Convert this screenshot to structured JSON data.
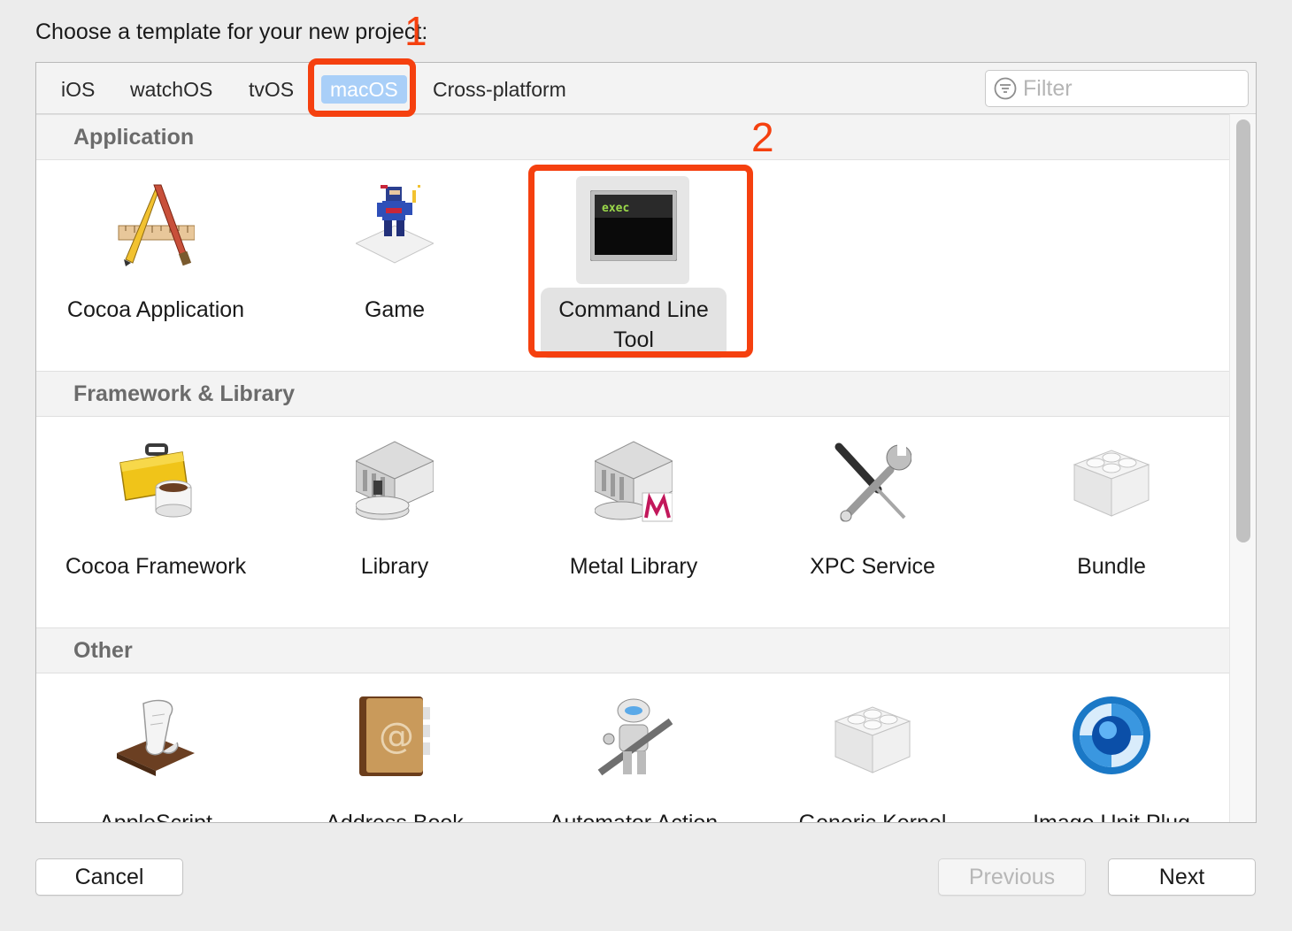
{
  "prompt": "Choose a template for your new project:",
  "tabs": [
    {
      "label": "iOS"
    },
    {
      "label": "watchOS"
    },
    {
      "label": "tvOS"
    },
    {
      "label": "macOS",
      "selected": true
    },
    {
      "label": "Cross-platform"
    }
  ],
  "filter": {
    "placeholder": "Filter",
    "icon": "filter-icon"
  },
  "sections": [
    {
      "title": "Application",
      "items": [
        {
          "label": "Cocoa Application",
          "icon": "cocoa-application-icon"
        },
        {
          "label": "Game",
          "icon": "game-icon"
        },
        {
          "label": "Command Line\nTool",
          "icon": "terminal-exec-icon",
          "selected": true,
          "icon_text": "exec"
        }
      ]
    },
    {
      "title": "Framework & Library",
      "items": [
        {
          "label": "Cocoa Framework",
          "icon": "toolbox-coffee-icon"
        },
        {
          "label": "Library",
          "icon": "library-building-icon"
        },
        {
          "label": "Metal Library",
          "icon": "metal-library-icon"
        },
        {
          "label": "XPC Service",
          "icon": "screwdriver-wrench-icon"
        },
        {
          "label": "Bundle",
          "icon": "lego-brick-icon"
        }
      ]
    },
    {
      "title": "Other",
      "items": [
        {
          "label": "AppleScript",
          "icon": "applescript-scroll-icon"
        },
        {
          "label": "Address Book",
          "icon": "address-book-icon"
        },
        {
          "label": "Automator Action",
          "icon": "automator-robot-icon"
        },
        {
          "label": "Generic Kernel",
          "icon": "kernel-brick-icon"
        },
        {
          "label": "Image Unit Plug",
          "icon": "image-unit-icon"
        }
      ]
    }
  ],
  "annotations": [
    {
      "number": "1"
    },
    {
      "number": "2"
    }
  ],
  "buttons": {
    "cancel": "Cancel",
    "previous": "Previous",
    "next": "Next"
  },
  "colors": {
    "annotation": "#f5400f",
    "selected_tab": "#a9cff8"
  }
}
